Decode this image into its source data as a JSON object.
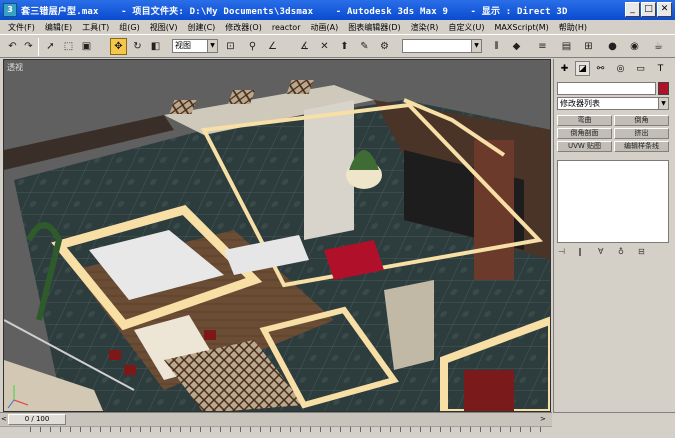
{
  "titlebar": {
    "title": "套三错层户型.max    - 项目文件夹: D:\\My Documents\\3dsmax    - Autodesk 3ds Max 9    - 显示 : Direct 3D",
    "icon_label": "3",
    "min_label": "_",
    "max_label": "□",
    "close_label": "✕"
  },
  "menu": [
    "文件(F)",
    "编辑(E)",
    "工具(T)",
    "组(G)",
    "视图(V)",
    "创建(C)",
    "修改器(O)",
    "reactor",
    "动画(A)",
    "图表编辑器(D)",
    "渲染(R)",
    "自定义(U)",
    "MAXScript(M)",
    "帮助(H)"
  ],
  "toolbar": {
    "view_combo": "视图",
    "selection_set_combo": ""
  },
  "viewport": {
    "label": "透视"
  },
  "command_panel": {
    "modifier_list": "修改器列表",
    "buttons": [
      "弯曲",
      "倒角",
      "倒角剖面",
      "挤出",
      "UVW 贴图",
      "编辑样条线"
    ]
  },
  "timeline": {
    "frame_display": "0 / 100",
    "left_marker": "<",
    "right_marker": ">"
  },
  "colors": {
    "titlebar": "#0a4bd0",
    "object_color": "#b0102a",
    "glow_frame": "#f7dfa6",
    "floor": "#2e3d3e"
  },
  "icons": {
    "cmd_tabs": [
      "create-icon",
      "modify-icon",
      "hierarchy-icon",
      "motion-icon",
      "display-icon",
      "utilities-icon"
    ]
  }
}
